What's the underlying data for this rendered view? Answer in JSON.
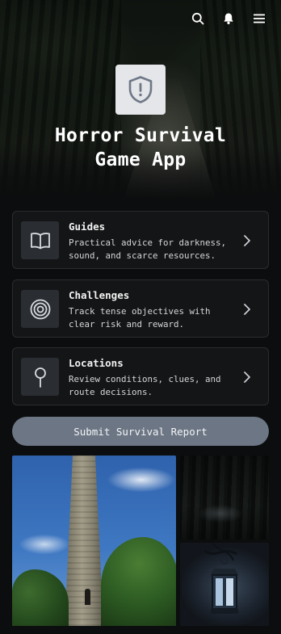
{
  "app": {
    "title": "Horror Survival Game App"
  },
  "header": {
    "icons": [
      "search-icon",
      "bell-icon",
      "menu-icon"
    ]
  },
  "cards": [
    {
      "id": "guides",
      "title": "Guides",
      "description": "Practical advice for darkness, sound, and scarce resources.",
      "icon": "book-icon"
    },
    {
      "id": "challenges",
      "title": "Challenges",
      "description": "Track tense objectives with clear risk and reward.",
      "icon": "target-icon"
    },
    {
      "id": "locations",
      "title": "Locations",
      "description": "Review conditions, clues, and route decisions.",
      "icon": "map-pin-icon"
    }
  ],
  "actions": {
    "submit_label": "Submit Survival Report"
  },
  "colors": {
    "background": "#0c0d0e",
    "card": "#141517",
    "card_border": "#2a2c30",
    "icon_box": "#2a2d31",
    "button": "#6c7684",
    "logo_bg": "#e4e6e9",
    "logo_fg": "#6f7887"
  }
}
